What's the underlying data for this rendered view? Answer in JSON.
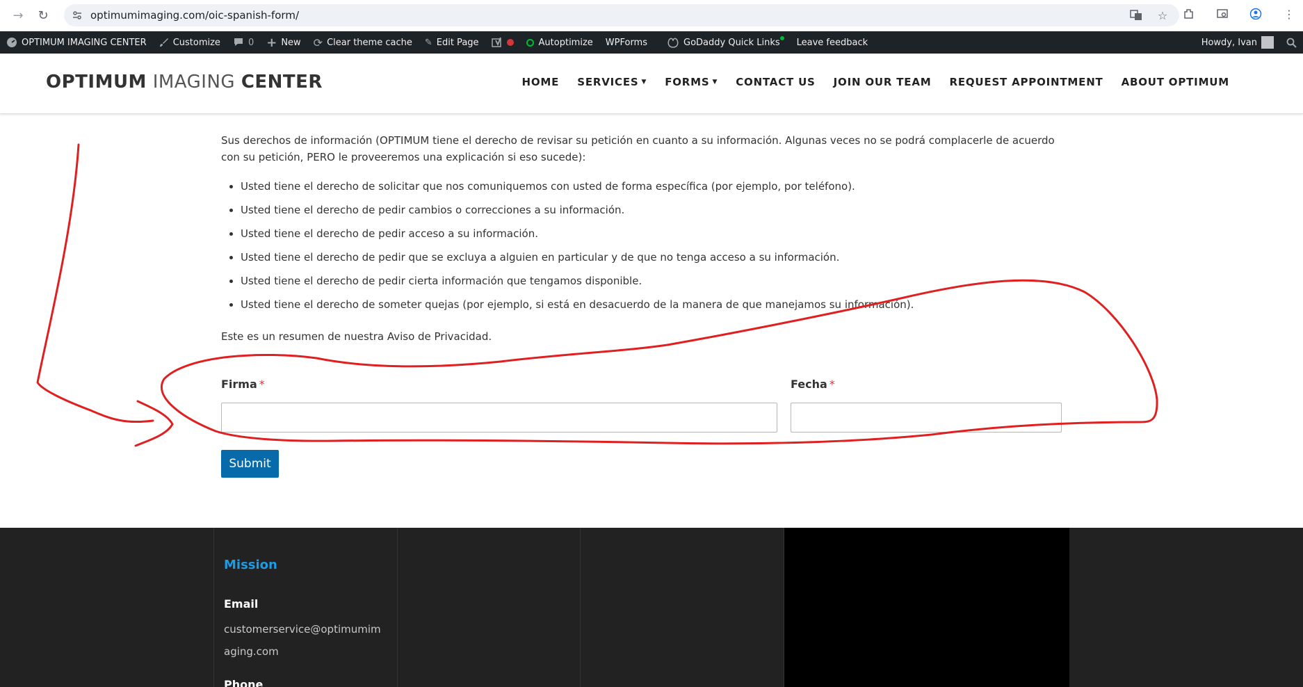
{
  "browser": {
    "url": "optimumimaging.com/oic-spanish-form/"
  },
  "adminbar": {
    "site_name": "OPTIMUM IMAGING CENTER",
    "customize": "Customize",
    "comments_count": "0",
    "new": "New",
    "clear_cache": "Clear theme cache",
    "edit_page": "Edit Page",
    "autoptimize": "Autoptimize",
    "wpforms": "WPForms",
    "godaddy": "GoDaddy Quick Links",
    "feedback": "Leave feedback",
    "howdy": "Howdy, Ivan"
  },
  "header": {
    "logo_part1": "OPTIMUM",
    "logo_part2": "IMAGING",
    "logo_part3": "CENTER",
    "nav": [
      {
        "label": "HOME"
      },
      {
        "label": "SERVICES"
      },
      {
        "label": "FORMS"
      },
      {
        "label": "CONTACT US"
      },
      {
        "label": "JOIN OUR TEAM"
      },
      {
        "label": "REQUEST APPOINTMENT"
      },
      {
        "label": "ABOUT OPTIMUM"
      }
    ]
  },
  "content": {
    "intro": "Sus derechos de información (OPTIMUM tiene el derecho de revisar su petición en cuanto a su información. Algunas veces no se podrá complacerle de acuerdo con su petición, PERO le proveeremos una explicación si eso sucede):",
    "rights": [
      "Usted tiene el derecho de solicitar que nos comuniquemos con usted de forma específica (por ejemplo, por teléfono).",
      "Usted tiene el derecho de pedir cambios o correcciones a su información.",
      "Usted tiene el derecho de pedir acceso a su información.",
      "Usted tiene el derecho de pedir que se excluya a alguien en particular y de que no tenga acceso a su información.",
      "Usted tiene el derecho de pedir cierta información que tengamos disponible.",
      "Usted tiene el derecho de someter quejas (por ejemplo, si está en desacuerdo de la manera de que manejamos su información)."
    ],
    "summary": "Este es un resumen de nuestra Aviso de Privacidad."
  },
  "form": {
    "firma_label": "Firma",
    "fecha_label": "Fecha",
    "required_mark": "*",
    "firma_value": "",
    "fecha_value": "",
    "submit_label": "Submit"
  },
  "footer": {
    "mission": "Mission",
    "email_label": "Email",
    "email": "customerservice@optimumimaging.com",
    "phone_label": "Phone"
  },
  "colors": {
    "adminbar_bg": "#1d2327",
    "submit_bg": "#066aab",
    "footer_bg": "#222222",
    "mission_color": "#1e9be3",
    "annotation": "#e02020"
  }
}
